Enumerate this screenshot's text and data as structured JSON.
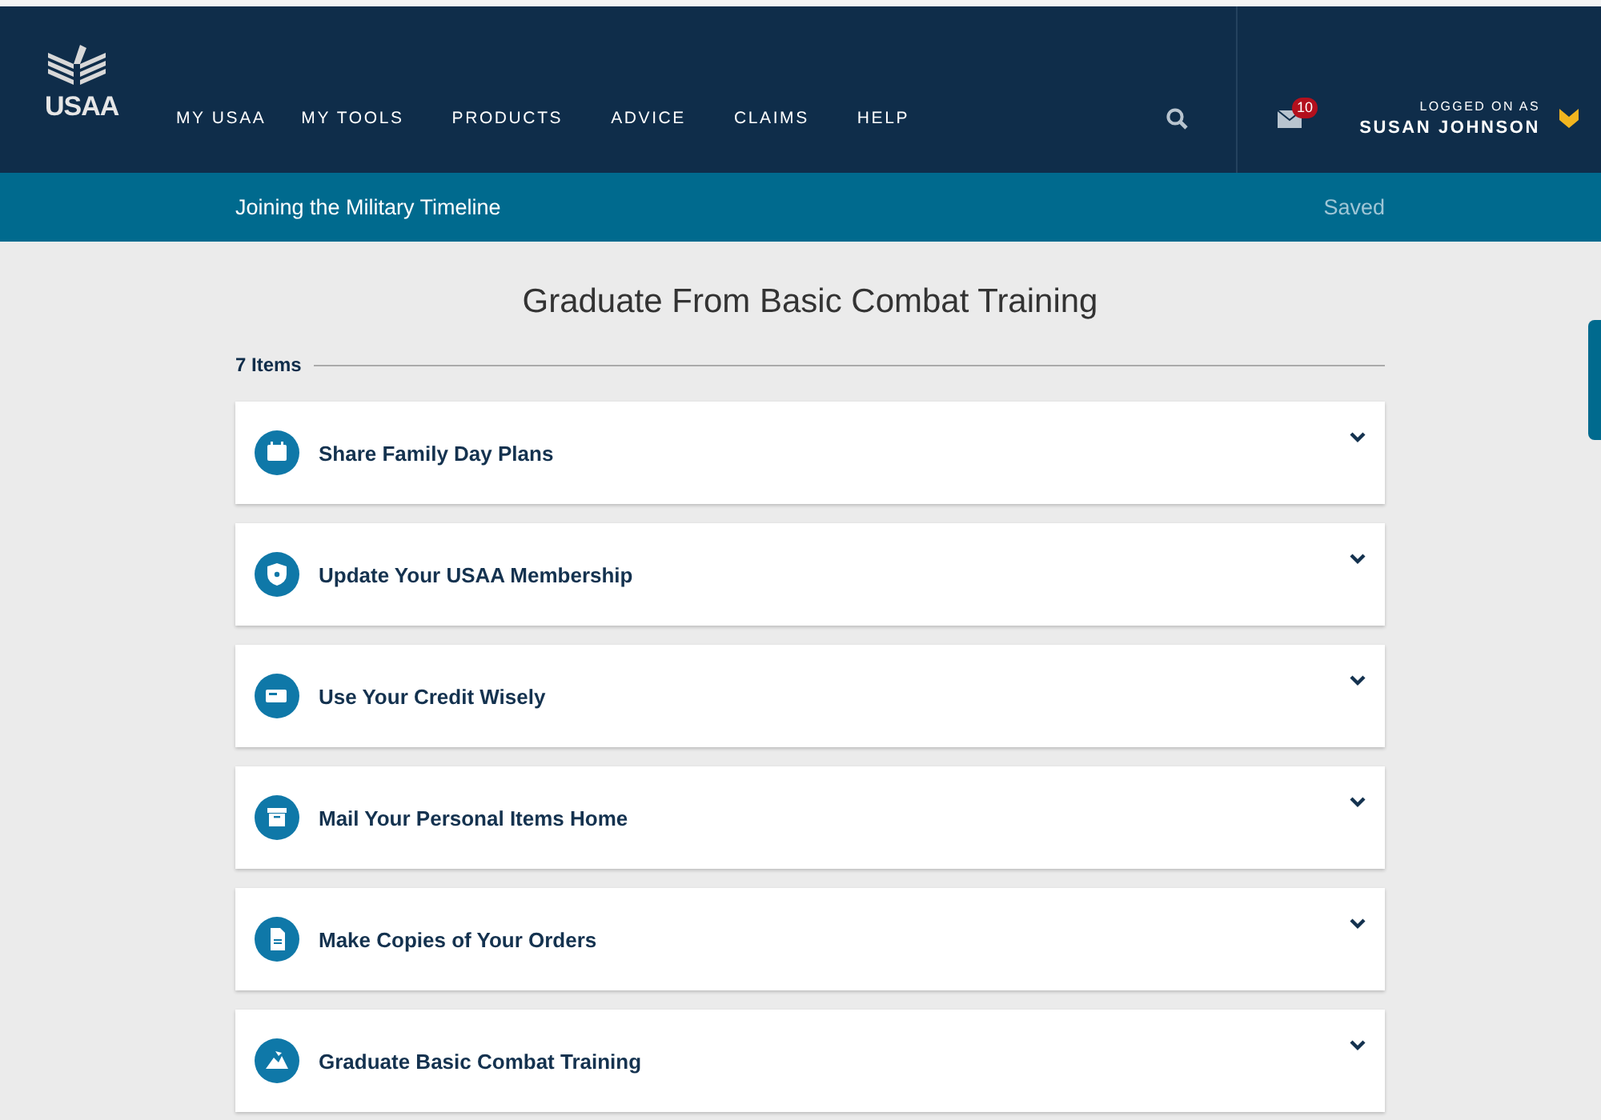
{
  "header": {
    "brand": "USAA",
    "nav": [
      "MY USAA",
      "MY TOOLS",
      "PRODUCTS",
      "ADVICE",
      "CLAIMS",
      "HELP"
    ],
    "messages_count": "10",
    "logged_on_label": "LOGGED ON AS",
    "user_name": "SUSAN JOHNSON"
  },
  "subbar": {
    "title": "Joining the Military Timeline",
    "status": "Saved"
  },
  "page_title": "Graduate From Basic Combat Training",
  "items_count": "7 Items",
  "items": [
    {
      "kind": "calendar",
      "title": "Share Family Day Plans",
      "expanded": false
    },
    {
      "kind": "shield",
      "title": "Update Your USAA Membership",
      "expanded": false
    },
    {
      "kind": "card",
      "title": "Use Your Credit Wisely",
      "expanded": false
    },
    {
      "kind": "box",
      "title": "Mail Your Personal Items Home",
      "expanded": false
    },
    {
      "kind": "document",
      "title": "Make Copies of Your Orders",
      "expanded": false
    },
    {
      "kind": "mountain",
      "title": "Graduate Basic Combat Training",
      "expanded": false
    }
  ]
}
